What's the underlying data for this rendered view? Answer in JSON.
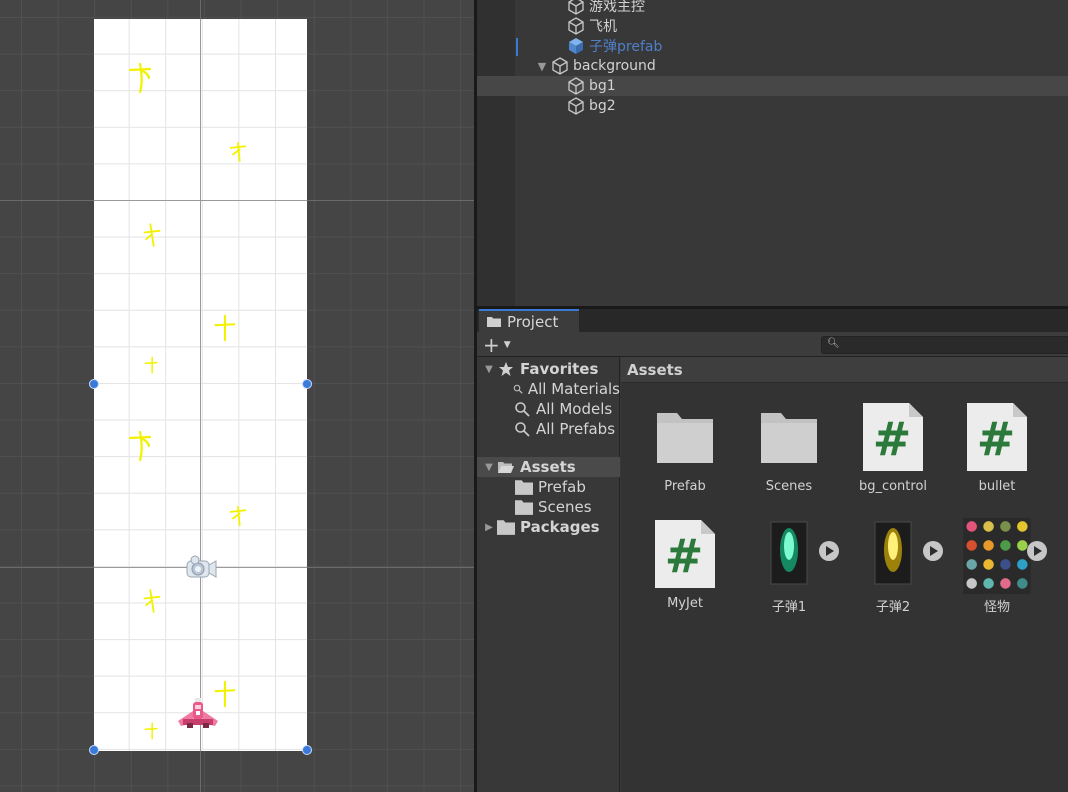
{
  "hierarchy": {
    "items": [
      {
        "label": "游戏主控"
      },
      {
        "label": "飞机"
      },
      {
        "label": "子弹prefab"
      },
      {
        "label": "background"
      },
      {
        "label": "bg1"
      },
      {
        "label": "bg2"
      }
    ]
  },
  "project": {
    "tab_label": "Project",
    "add_label": "+",
    "search_placeholder": "",
    "tree": {
      "favorites": "Favorites",
      "all_materials": "All Materials",
      "all_models": "All Models",
      "all_prefabs": "All Prefabs",
      "assets": "Assets",
      "prefab": "Prefab",
      "scenes": "Scenes",
      "packages": "Packages"
    },
    "breadcrumb": "Assets",
    "assets": [
      {
        "label": "Prefab",
        "icon": "folder-icon"
      },
      {
        "label": "Scenes",
        "icon": "folder-icon"
      },
      {
        "label": "bg_control",
        "icon": "csharp-script-icon"
      },
      {
        "label": "bullet",
        "icon": "csharp-script-icon"
      },
      {
        "label": "MyJet",
        "icon": "csharp-script-icon"
      },
      {
        "label": "子弹1",
        "icon": "green-bullet-sprite"
      },
      {
        "label": "子弹2",
        "icon": "yellow-bullet-sprite"
      },
      {
        "label": "怪物",
        "icon": "monster-spritesheet"
      }
    ]
  },
  "colors": {
    "accent_blue": "#3a79d4",
    "script_green": "#2b7a3b",
    "yellow_glyph": "#f2f200"
  }
}
